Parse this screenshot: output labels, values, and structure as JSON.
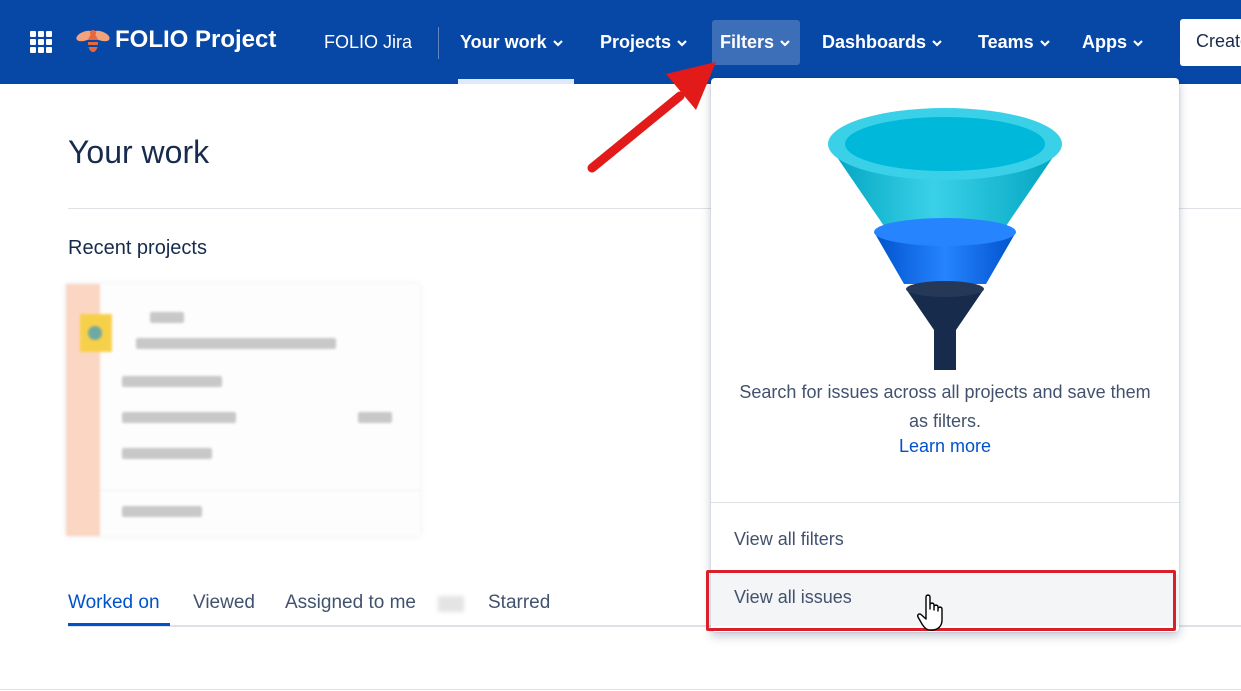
{
  "topnav": {
    "brand": "FOLIO Project",
    "site": "FOLIO Jira",
    "items": [
      {
        "label": "Your work"
      },
      {
        "label": "Projects"
      },
      {
        "label": "Filters"
      },
      {
        "label": "Dashboards"
      },
      {
        "label": "Teams"
      },
      {
        "label": "Apps"
      }
    ],
    "create_label": "Create",
    "bg_color": "#0747a6"
  },
  "main": {
    "title": "Your work",
    "recent_projects_title": "Recent projects",
    "tabs": [
      {
        "label": "Worked on",
        "active": true
      },
      {
        "label": "Viewed"
      },
      {
        "label": "Assigned to me"
      },
      {
        "label": "Starred"
      }
    ]
  },
  "filters_menu": {
    "description": "Search for issues across all projects and save them as filters.",
    "learn_more": "Learn more",
    "items": [
      {
        "label": "View all filters"
      },
      {
        "label": "View all issues",
        "hovered": true
      }
    ]
  },
  "annotations": {
    "arrow_color": "#e21a1a",
    "highlight_color": "#d9202a"
  }
}
